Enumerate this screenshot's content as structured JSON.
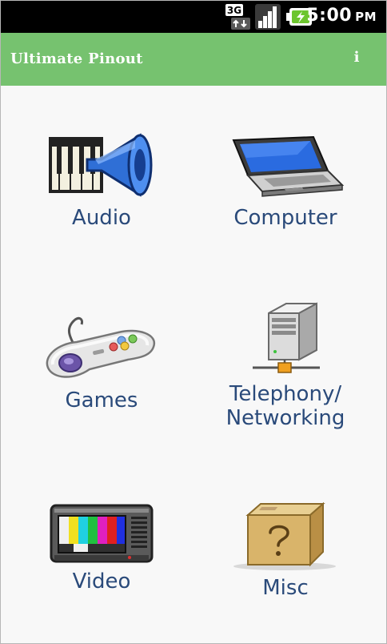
{
  "status_bar": {
    "time": "5:00",
    "ampm": "PM",
    "network_label": "3G"
  },
  "app": {
    "title": "Ultimate Pinout",
    "info_label": "i"
  },
  "categories": [
    {
      "label": "Audio",
      "icon": "audio-speaker-icon"
    },
    {
      "label": "Computer",
      "icon": "laptop-icon"
    },
    {
      "label": "Games",
      "icon": "gamepad-icon"
    },
    {
      "label": "Telephony/",
      "label2": "Networking",
      "icon": "network-server-icon"
    },
    {
      "label": "Video",
      "icon": "tv-icon"
    },
    {
      "label": "Misc",
      "icon": "mystery-box-icon"
    }
  ],
  "colors": {
    "title_bar": "#76c26f",
    "label_text": "#2a4a7a",
    "background": "#f8f8f8"
  }
}
